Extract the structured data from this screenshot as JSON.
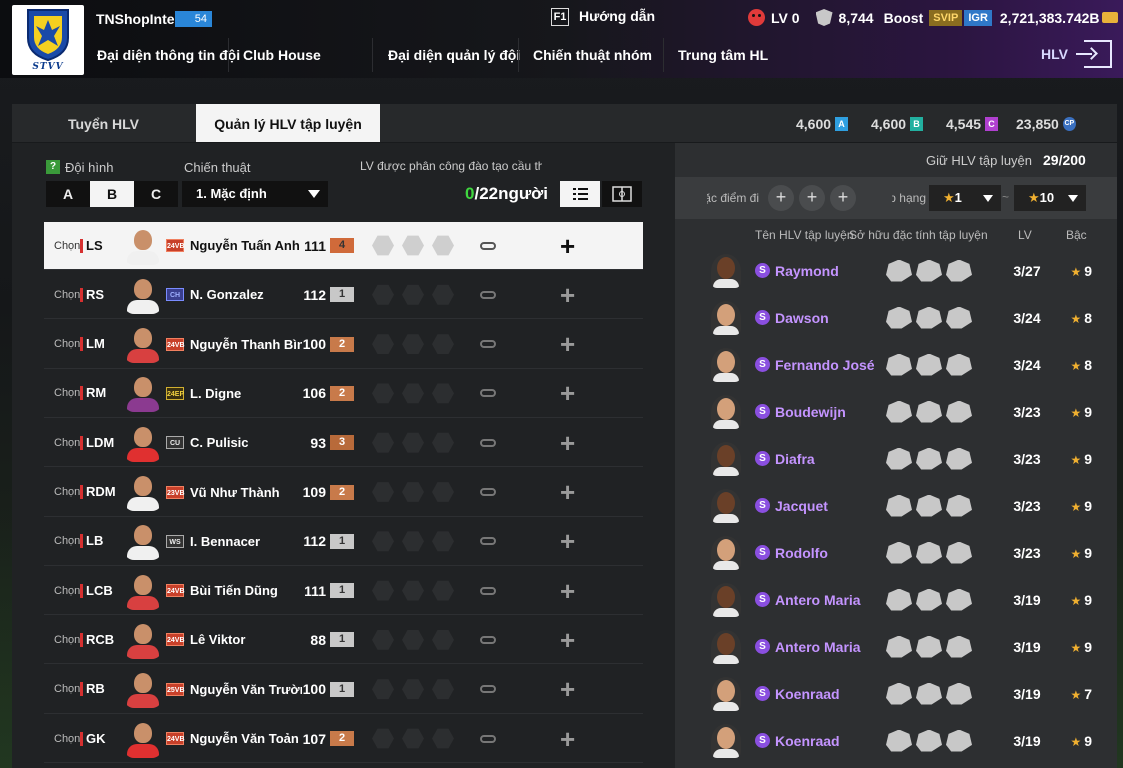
{
  "user": {
    "name": "TNShopInter",
    "level": "54"
  },
  "header": {
    "f1_key": "F1",
    "guide_label": "Hướng dẫn",
    "lv_label": "LV 0",
    "shield_value": "8,744",
    "boost_label": "Boost",
    "svip_label": "SVIP",
    "igr_label": "IGR",
    "coins": "2,721,383.742B"
  },
  "nav": [
    "Đại diện thông tin đội",
    "Club House",
    "Đại diện quản lý đội",
    "Chiến thuật nhóm",
    "Trung tâm HL"
  ],
  "nav_right": "HLV",
  "tabs": {
    "recruit": "Tuyển HLV",
    "manage": "Quản lý HLV tập luyện"
  },
  "resources": [
    {
      "value": "4,600",
      "badge": "A",
      "color": "#2f9fe0"
    },
    {
      "value": "4,600",
      "badge": "B",
      "color": "#22b0a0"
    },
    {
      "value": "4,545",
      "badge": "C",
      "color": "#b040d0"
    },
    {
      "value": "23,850",
      "badge": "CP",
      "color": "#3a70c0"
    }
  ],
  "left": {
    "q_mark": "?",
    "formation_label": "Đội hình",
    "formations": [
      "A",
      "B",
      "C"
    ],
    "active_formation": "B",
    "tactic_label": "Chiến thuật",
    "tactic_value": "1. Mặc định",
    "assigned_label": "LV được phân công đào tạo cầu thủ",
    "assigned_count": "0",
    "assigned_total": "/22người",
    "choose_label": "Chọn",
    "players": [
      {
        "pos": "LS",
        "season": "24VB",
        "name": "Nguyễn Tuấn Anh",
        "ovr": "111",
        "grade": "4"
      },
      {
        "pos": "RS",
        "season": "CH",
        "name": "N. Gonzalez",
        "ovr": "112",
        "grade": "1"
      },
      {
        "pos": "LM",
        "season": "24VB",
        "name": "Nguyễn Thanh Bình",
        "ovr": "100",
        "grade": "2"
      },
      {
        "pos": "RM",
        "season": "24EP",
        "name": "L. Digne",
        "ovr": "106",
        "grade": "2"
      },
      {
        "pos": "LDM",
        "season": "CU",
        "name": "C. Pulisic",
        "ovr": "93",
        "grade": "3"
      },
      {
        "pos": "RDM",
        "season": "23VB",
        "name": "Vũ Như Thành",
        "ovr": "109",
        "grade": "2"
      },
      {
        "pos": "LB",
        "season": "WS",
        "name": "I. Bennacer",
        "ovr": "112",
        "grade": "1"
      },
      {
        "pos": "LCB",
        "season": "24VB",
        "name": "Bùi Tiến Dũng",
        "ovr": "111",
        "grade": "1"
      },
      {
        "pos": "RCB",
        "season": "24VB",
        "name": "Lê Viktor",
        "ovr": "88",
        "grade": "1"
      },
      {
        "pos": "RB",
        "season": "25VB",
        "name": "Nguyễn Văn Trường",
        "ovr": "100",
        "grade": "1"
      },
      {
        "pos": "GK",
        "season": "24VB",
        "name": "Nguyễn Văn Toản",
        "ovr": "107",
        "grade": "2"
      }
    ]
  },
  "right": {
    "keep_label": "Giữ HLV tập luyện",
    "keep_value": "29/200",
    "filter_trait_label": "Đặc điểm đi",
    "filter_rank_label": "Xếp hạng",
    "star_min": "1",
    "star_max": "10",
    "columns": {
      "name": "Tên HLV tập luyện",
      "traits": "Sở hữu đặc tính tập luyện",
      "lv": "LV",
      "rank": "Bậc"
    },
    "coaches": [
      {
        "name": "Raymond",
        "lv": "3/27",
        "rank": "9"
      },
      {
        "name": "Dawson",
        "lv": "3/24",
        "rank": "8"
      },
      {
        "name": "Fernando José",
        "lv": "3/24",
        "rank": "8"
      },
      {
        "name": "Boudewijn",
        "lv": "3/23",
        "rank": "9"
      },
      {
        "name": "Diafra",
        "lv": "3/23",
        "rank": "9"
      },
      {
        "name": "Jacquet",
        "lv": "3/23",
        "rank": "9"
      },
      {
        "name": "Rodolfo",
        "lv": "3/23",
        "rank": "9"
      },
      {
        "name": "Antero Maria",
        "lv": "3/19",
        "rank": "9"
      },
      {
        "name": "Antero Maria",
        "lv": "3/19",
        "rank": "9"
      },
      {
        "name": "Koenraad",
        "lv": "3/19",
        "rank": "7"
      },
      {
        "name": "Koenraad",
        "lv": "3/19",
        "rank": "9"
      }
    ]
  }
}
